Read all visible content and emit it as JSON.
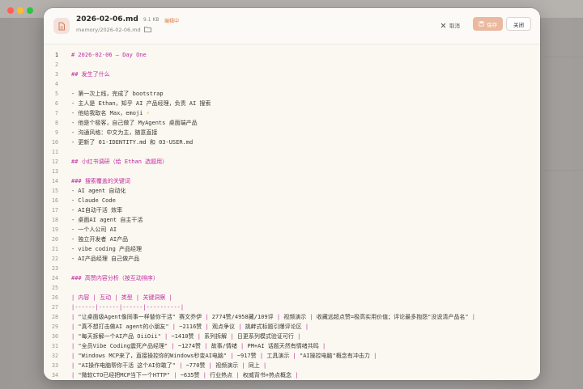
{
  "window": {
    "file_name": "2026-02-06.md",
    "file_size": "9.1 KB",
    "edit_state": "编辑中",
    "file_path": "memory/2026-02-06.md",
    "cancel_label": "取消",
    "save_label": "保存",
    "close_label": "关闭"
  },
  "colors": {
    "accent": "#e07a3c",
    "heading": "#c02a9d",
    "save_button": "#eab99f"
  },
  "editor": {
    "lines": [
      {
        "n": "1",
        "text": "# 2026-02-06 — Day One",
        "kind": "h1"
      },
      {
        "n": "2",
        "text": "",
        "kind": "body"
      },
      {
        "n": "3",
        "text": "## 发生了什么",
        "kind": "h2"
      },
      {
        "n": "4",
        "text": "",
        "kind": "body"
      },
      {
        "n": "5",
        "text": "- 第一次上线，完成了 bootstrap",
        "kind": "body"
      },
      {
        "n": "6",
        "text": "- 主人是 Ethan，知乎 AI 产品经理，负责 AI 搜索",
        "kind": "body"
      },
      {
        "n": "7",
        "text": "- 他给我取名 Max，emoji ⚡",
        "kind": "body"
      },
      {
        "n": "8",
        "text": "- 他是个极客，自己做了 MyAgents 桌面端产品",
        "kind": "body"
      },
      {
        "n": "9",
        "text": "- 沟通风格：中文为主，随意直接",
        "kind": "body"
      },
      {
        "n": "10",
        "text": "- 更新了 01-IDENTITY.md 和 03-USER.md",
        "kind": "body"
      },
      {
        "n": "11",
        "text": "",
        "kind": "body"
      },
      {
        "n": "12",
        "text": "## 小红书调研（给 Ethan 选题用）",
        "kind": "h2"
      },
      {
        "n": "13",
        "text": "",
        "kind": "body"
      },
      {
        "n": "14",
        "text": "### 搜索覆盖的关键词",
        "kind": "h3"
      },
      {
        "n": "15",
        "text": "- AI agent 自动化",
        "kind": "body"
      },
      {
        "n": "16",
        "text": "- Claude Code",
        "kind": "body"
      },
      {
        "n": "17",
        "text": "- AI自动干活 效率",
        "kind": "body"
      },
      {
        "n": "18",
        "text": "- 桌面AI agent 自主干活",
        "kind": "body"
      },
      {
        "n": "19",
        "text": "- 一个人公司 AI",
        "kind": "body"
      },
      {
        "n": "20",
        "text": "- 独立开发者 AI产品",
        "kind": "body"
      },
      {
        "n": "21",
        "text": "- vibe coding 产品经理",
        "kind": "body"
      },
      {
        "n": "22",
        "text": "- AI产品经理 自己做产品",
        "kind": "body"
      },
      {
        "n": "23",
        "text": "",
        "kind": "body"
      },
      {
        "n": "24",
        "text": "### 高赞内容分析（按互动排序）",
        "kind": "h3"
      },
      {
        "n": "25",
        "text": "",
        "kind": "body"
      },
      {
        "n": "26",
        "text": "| 内容 | 互动 | 类型 | 关键洞察 |",
        "kind": "tbl"
      },
      {
        "n": "27",
        "text": "|------|------|------|----------|",
        "kind": "tbl"
      },
      {
        "n": "28",
        "text": "| \"让桌面级Agent像同事一样替你干活\" 赛文乔伊 | 2774赞/4958藏/109评 | 视频演示 | 收藏远超点赞=极高实用价值；评论最多抱怨\"没说清产品名\" |",
        "kind": "row"
      },
      {
        "n": "29",
        "text": "| \"真不想打击做AI agent的小朋友\" | ~2116赞 | 观点争议 | 挑衅式标题引爆评论区 |",
        "kind": "row"
      },
      {
        "n": "30",
        "text": "| \"每天拆解一个AI产品 OiiOii\" | ~1410赞 | 系列拆解 | 日更系列模式验证可行 |",
        "kind": "row"
      },
      {
        "n": "31",
        "text": "| \"全员Vibe Coding震死产品经理\" | ~1274赞 | 故事/情绪 | PM+AI 话题天然有情绪共鸣 |",
        "kind": "row"
      },
      {
        "n": "32",
        "text": "| \"Windows MCP来了，直接操控你的Windows秒变AI电脑\" | ~917赞 | 工具演示 | \"AI操控电脑\"概念有冲击力 |",
        "kind": "row"
      },
      {
        "n": "33",
        "text": "| \"AI操作电脑帮你干活 这个AI你敢了\" | ~770赞 | 视频演示 | 同上 |",
        "kind": "row"
      },
      {
        "n": "34",
        "text": "| \"微软CTO已经把MCP当下一个HTTP\" | ~635赞 | 行业热点 | 权威背书+热点概念 |",
        "kind": "row"
      }
    ]
  }
}
